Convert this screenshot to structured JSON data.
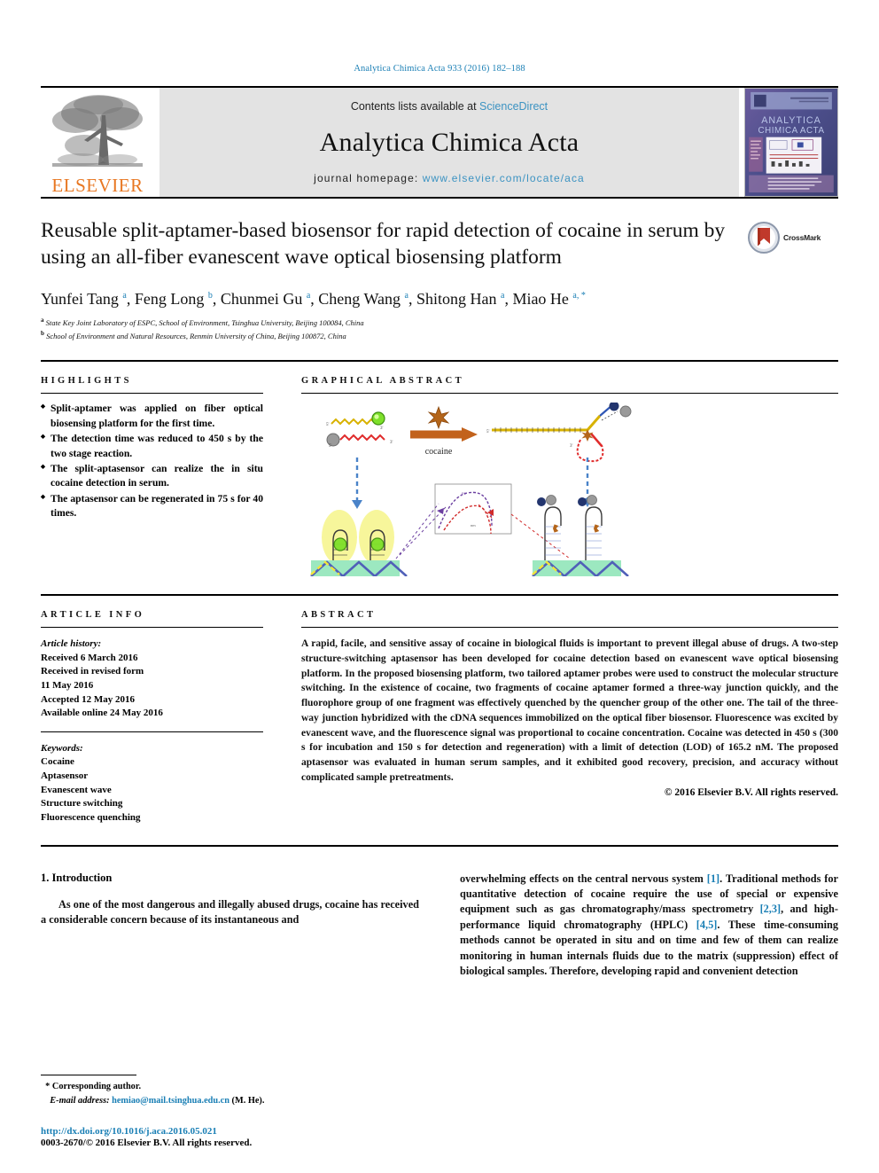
{
  "running_head": "Analytica Chimica Acta 933 (2016) 182–188",
  "masthead": {
    "publisher_name": "ELSEVIER",
    "contents_prefix": "Contents lists available at ",
    "sciencedirect": "ScienceDirect",
    "journal_title": "Analytica Chimica Acta",
    "homepage_prefix": "journal homepage: ",
    "homepage_url": "www.elsevier.com/locate/aca",
    "cover_title_line1": "ANALYTICA",
    "cover_title_line2": "CHIMICA ACTA"
  },
  "article": {
    "title": "Reusable split-aptamer-based biosensor for rapid detection of cocaine in serum by using an all-fiber evanescent wave optical biosensing platform",
    "crossmark_label": "CrossMark",
    "authors_html": "Yunfei Tang <sup>a</sup>, Feng Long <sup>b</sup>, Chunmei Gu <sup>a</sup>, Cheng Wang <sup>a</sup>, Shitong Han <sup>a</sup>, Miao He <sup>a, *</sup>",
    "affiliations": [
      {
        "marker": "a",
        "text": "State Key Joint Laboratory of ESPC, School of Environment, Tsinghua University, Beijing 100084, China"
      },
      {
        "marker": "b",
        "text": "School of Environment and Natural Resources, Renmin University of China, Beijing 100872, China"
      }
    ]
  },
  "highlights": {
    "heading": "HIGHLIGHTS",
    "items": [
      "Split-aptamer was applied on fiber optical biosensing platform for the first time.",
      "The detection time was reduced to 450 s by the two stage reaction.",
      "The split-aptasensor can realize the in situ cocaine detection in serum.",
      "The aptasensor can be regenerated in 75 s for 40 times."
    ]
  },
  "graphical_abstract": {
    "heading": "GRAPHICAL ABSTRACT",
    "label_cocaine": "cocaine"
  },
  "article_info": {
    "heading": "ARTICLE INFO",
    "history_label": "Article history:",
    "history": [
      "Received 6 March 2016",
      "Received in revised form",
      "11 May 2016",
      "Accepted 12 May 2016",
      "Available online 24 May 2016"
    ],
    "keywords_label": "Keywords:",
    "keywords": [
      "Cocaine",
      "Aptasensor",
      "Evanescent wave",
      "Structure switching",
      "Fluorescence quenching"
    ]
  },
  "abstract": {
    "heading": "ABSTRACT",
    "text": "A rapid, facile, and sensitive assay of cocaine in biological fluids is important to prevent illegal abuse of drugs. A two-step structure-switching aptasensor has been developed for cocaine detection based on evanescent wave optical biosensing platform. In the proposed biosensing platform, two tailored aptamer probes were used to construct the molecular structure switching. In the existence of cocaine, two fragments of cocaine aptamer formed a three-way junction quickly, and the fluorophore group of one fragment was effectively quenched by the quencher group of the other one. The tail of the three-way junction hybridized with the cDNA sequences immobilized on the optical fiber biosensor. Fluorescence was excited by evanescent wave, and the fluorescence signal was proportional to cocaine concentration. Cocaine was detected in 450 s (300 s for incubation and 150 s for detection and regeneration) with a limit of detection (LOD) of 165.2 nM. The proposed aptasensor was evaluated in human serum samples, and it exhibited good recovery, precision, and accuracy without complicated sample pretreatments.",
    "copyright": "© 2016 Elsevier B.V. All rights reserved."
  },
  "introduction": {
    "section_number": "1.",
    "section_title": "Introduction",
    "left_paragraph": "As one of the most dangerous and illegally abused drugs, cocaine has received a considerable concern because of its instantaneous and",
    "right_paragraph_parts": [
      {
        "t": "overwhelming effects on the central nervous system "
      },
      {
        "t": "[1]",
        "ref": true
      },
      {
        "t": ". Traditional methods for quantitative detection of cocaine require the use of special or expensive equipment such as gas chromatography/mass spectrometry "
      },
      {
        "t": "[2,3]",
        "ref": true
      },
      {
        "t": ", and high-performance liquid chromatography (HPLC) "
      },
      {
        "t": "[4,5]",
        "ref": true
      },
      {
        "t": ". These time-consuming methods cannot be operated in situ and on time and few of them can realize monitoring in human internals fluids due to the matrix (suppression) effect of biological samples. Therefore, developing rapid and convenient detection"
      }
    ]
  },
  "footer": {
    "corresponding_marker": "*",
    "corresponding_label": "Corresponding author.",
    "email_label": "E-mail address:",
    "email": "hemiao@mail.tsinghua.edu.cn",
    "email_suffix": "(M. He).",
    "doi": "http://dx.doi.org/10.1016/j.aca.2016.05.021",
    "issn_line": "0003-2670/© 2016 Elsevier B.V. All rights reserved."
  },
  "colors": {
    "link_blue": "#1a7fb5",
    "sciencedirect_blue": "#3c93c2",
    "elsevier_orange": "#E87722",
    "band_grey": "#e3e3e3"
  }
}
